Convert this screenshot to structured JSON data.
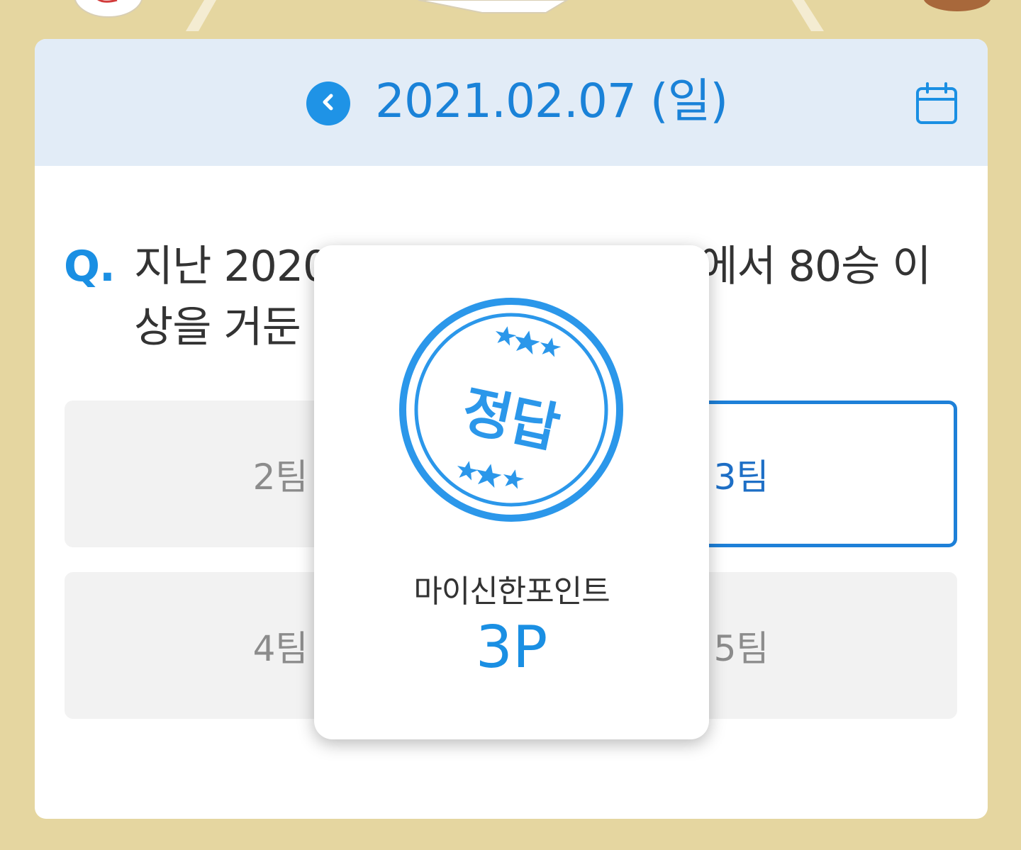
{
  "date_bar": {
    "date_label": "2021.02.07 (일)",
    "prev_icon": "chevron-left-icon",
    "calendar_icon": "calendar-icon"
  },
  "question": {
    "prefix": "Q.",
    "text": "지난 2020 시즌 KBO 리그 시즌에서 80승 이상을 거둔 팀은 총 몇팀일까요?"
  },
  "options": [
    {
      "label": "2팀",
      "selected": false
    },
    {
      "label": "3팀",
      "selected": true
    },
    {
      "label": "4팀",
      "selected": false
    },
    {
      "label": "5팀",
      "selected": false
    }
  ],
  "result_modal": {
    "stamp_text": "정답",
    "stamp_icon": "stars-icon",
    "points_label": "마이신한포인트",
    "points_value": "3P"
  },
  "colors": {
    "background": "#e5d6a0",
    "accent": "#1a8fe3",
    "date_bar": "#e2ecf7",
    "selected_border": "#1e80d8"
  }
}
